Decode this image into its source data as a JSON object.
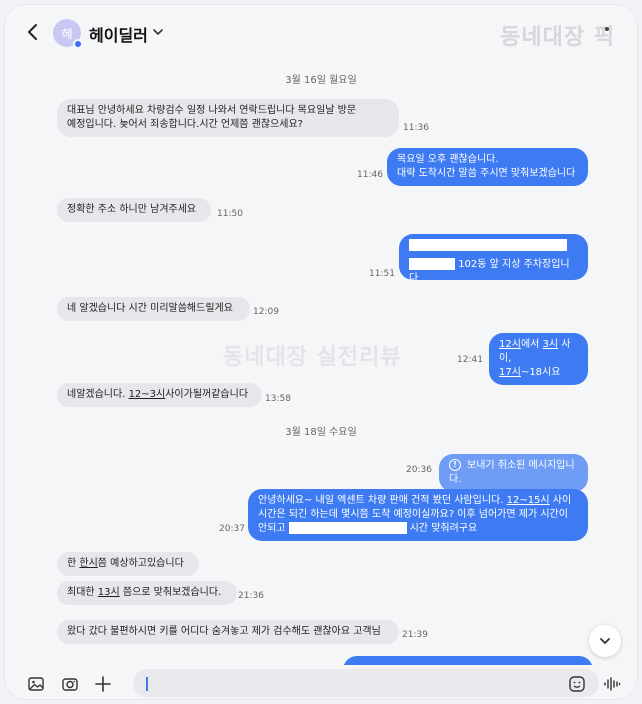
{
  "header": {
    "avatar_initial": "헤",
    "contact_name": "헤이딜러",
    "watermark": "동네대장 픽"
  },
  "watermark_center": "동네대장 실전리뷰",
  "dates": {
    "d1": "3월 16일 월요일",
    "d2": "3월 18일 수요일"
  },
  "messages": {
    "m1": {
      "line1": "대표님 안녕하세요 차량검수 일정 나와서 연락드립니다 목요일날 방문",
      "line2": "예정입니다. 늦어서 죄송합니다.시간 언제쯤 괜찮으세요?",
      "time": "11:36"
    },
    "m2": {
      "line1": "목요일 오후 괜찮습니다.",
      "line2": "대략 도착시간 말씀 주시면 맞춰보겠습니다",
      "time": "11:46"
    },
    "m3": {
      "text": "정확한 주소 하니만 남겨주세요",
      "time": "11:50"
    },
    "m4": {
      "line2": "102동 앞 지상 주차장입니다",
      "time": "11:51"
    },
    "m5": {
      "text": "네 알겠습니다 시간 미리말씀해드릴게요",
      "time": "12:09"
    },
    "m6": {
      "l1a": "12시",
      "l1b": "에서 ",
      "l1c": "3시",
      "l1d": " 사이,",
      "l2a": "17시",
      "l2b": "~18시요",
      "time": "12:41"
    },
    "m7": {
      "a": "네알겠습니다. ",
      "b": "12~3시",
      "c": "사이가될꺼같습니다",
      "time": "13:58"
    },
    "m8": {
      "text": "보내기 취소된 메시지입니다.",
      "time": "20:36"
    },
    "m9": {
      "l1a": "안녕하세요~ 내일 엑센트 차량 판매 건적 봤던 사람입니다. ",
      "l1b": "12~15시",
      "l1c": " 사이",
      "l2": "시간은 되긴 하는데 몇시쯤 도착 예정이실까요? 이후 넘어가면 제가 시간이",
      "l3a": "안되고",
      "l3b": "시간 맞춰려구요",
      "time": "20:37"
    },
    "m10": {
      "a": "한 ",
      "b": "한시",
      "c": "쯤 예상하고있습니다"
    },
    "m11": {
      "a": "최대한 ",
      "b": "13시",
      "c": " 쯤으로 맞춰보겠습니다.",
      "time": "21:36"
    },
    "m12": {
      "text": "왔다 갔다 불편하시면 키를 어디다 숨겨놓고 제가 검수해도 괜찮아요 고객님",
      "time": "21:39"
    }
  },
  "input": {
    "placeholder": ""
  },
  "colors": {
    "outgoing": "#3e7bf2",
    "incoming": "#e6e7ea",
    "background": "#f5f6f8"
  }
}
